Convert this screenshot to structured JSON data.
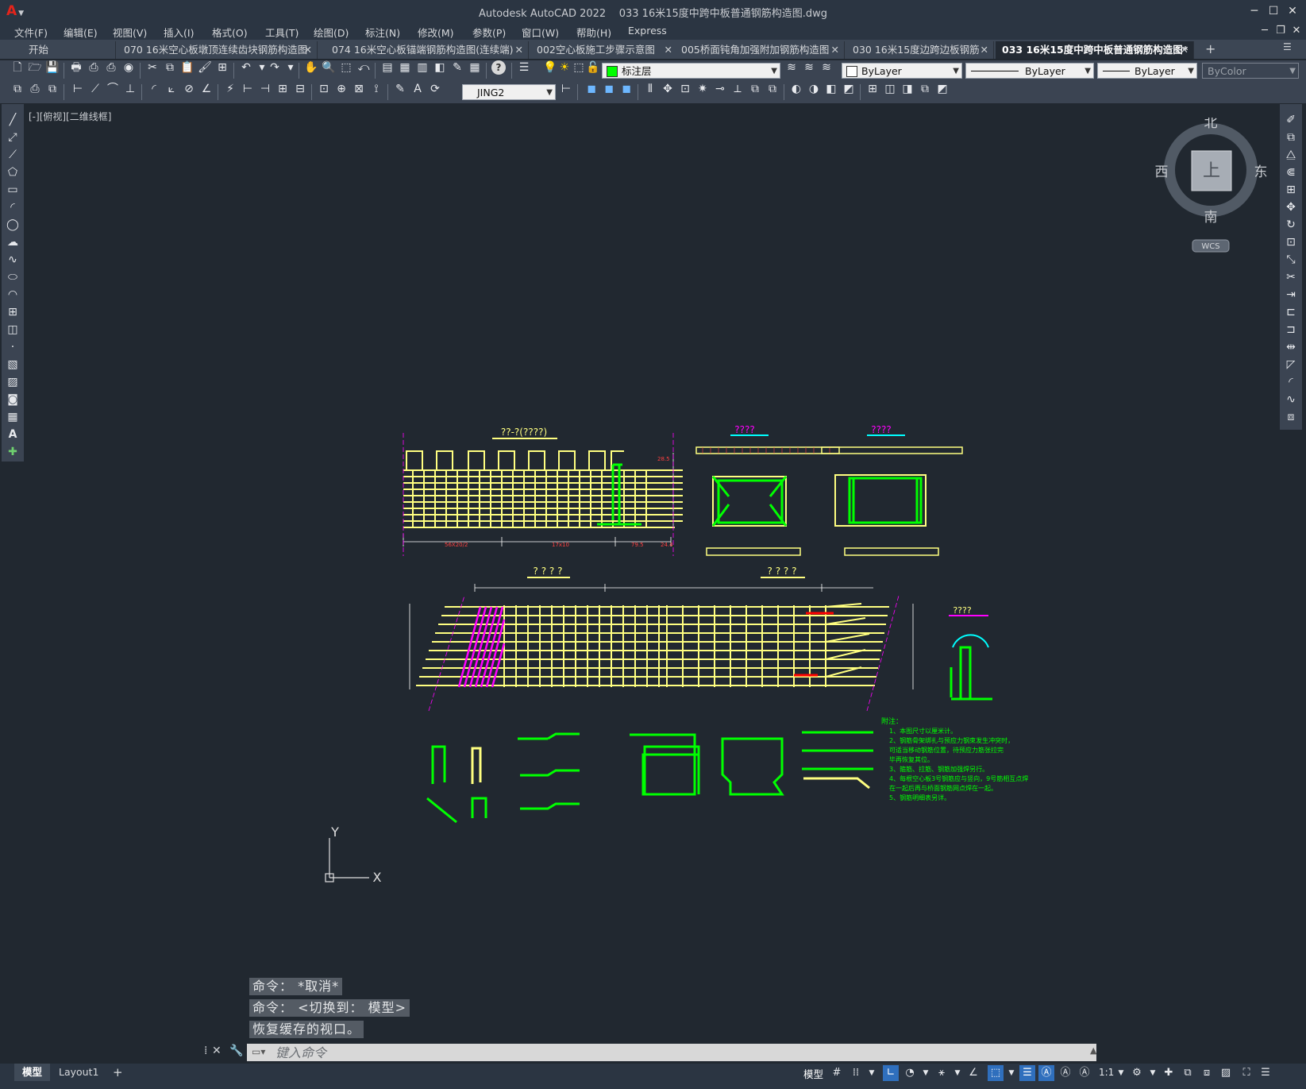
{
  "titlebar": {
    "app_name": "Autodesk AutoCAD 2022",
    "file_name": "033 16米15度中跨中板普通钢筋构造图.dwg",
    "logo_letter": "A"
  },
  "menu": [
    "文件(F)",
    "编辑(E)",
    "视图(V)",
    "插入(I)",
    "格式(O)",
    "工具(T)",
    "绘图(D)",
    "标注(N)",
    "修改(M)",
    "参数(P)",
    "窗口(W)",
    "帮助(H)",
    "Express"
  ],
  "tabs": [
    {
      "label": "开始",
      "active": false
    },
    {
      "label": "070 16米空心板墩顶连续齿块钢筋构造图",
      "active": false
    },
    {
      "label": "074  16米空心板锚端钢筋构造图(连续端)",
      "active": false
    },
    {
      "label": "002空心板施工步骤示意图",
      "active": false
    },
    {
      "label": "005桥面钝角加强附加钢筋构造图",
      "active": false
    },
    {
      "label": "030 16米15度边跨边板钢筋",
      "active": false
    },
    {
      "label": "033 16米15度中跨中板普通钢筋构造图*",
      "active": true
    }
  ],
  "toolbar": {
    "layer_value": "标注层",
    "color_value": "ByLayer",
    "linetype_value": "ByLayer",
    "lineweight_value": "ByLayer",
    "plotstyle_value": "ByColor",
    "dimstyle_value": "JING2"
  },
  "viewport": {
    "label": "[-][俯视][二维线框]"
  },
  "viewcube": {
    "north": "北",
    "south": "南",
    "east": "东",
    "west": "西",
    "face": "上",
    "wcs": "WCS"
  },
  "ucs": {
    "x_label": "X",
    "y_label": "Y"
  },
  "drawing": {
    "title_1": "??-?(????)",
    "title_2": "????",
    "title_3": "????",
    "title_4": "? ? ? ?",
    "title_5": "? ? ? ?",
    "title_6": "????",
    "notes_title": "附注：",
    "notes": [
      "1、本图尺寸以厘米计。",
      "2、钢筋骨架绑扎与预应力钢束发生冲突时，",
      "   可适当移动钢筋位置，待预应力筋张拉完",
      "   毕再恢复其位。",
      "3、箍筋、拉筋、钢筋加强焊另行。",
      "4、每根空心板3号钢筋应与竖向，9号筋相互点焊",
      "   在一起后再与桥面钢筋网点焊在一起。",
      "5、钢筋明细表另详。"
    ]
  },
  "command": {
    "history": [
      "命令： *取消*",
      "命令：  <切换到： 模型>",
      "恢复缓存的视口。"
    ],
    "placeholder": "键入命令"
  },
  "layout_tabs": [
    "模型",
    "Layout1"
  ],
  "status": {
    "model_label": "模型",
    "scale": "1:1"
  },
  "colors": {
    "canvas": "#212830",
    "yellow_rebar": "#ffff80",
    "green_rebar": "#00ff00",
    "magenta_rebar": "#ff00ff",
    "red_dim": "#ff0000",
    "cyan_title": "#00ffff",
    "blue_label": "#0000ff"
  }
}
